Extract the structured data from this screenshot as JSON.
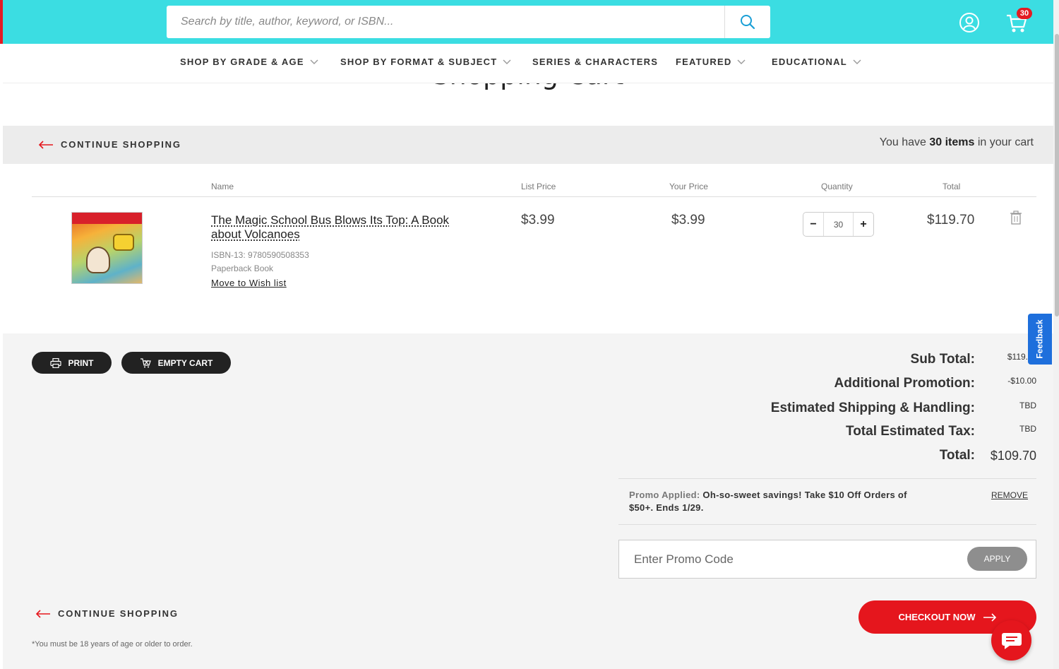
{
  "colors": {
    "header_bg": "#3bdde2",
    "accent_red": "#e5161d",
    "badge_red": "#e31b23",
    "feedback_blue": "#1e6fdc"
  },
  "header": {
    "search_placeholder": "Search by title, author, keyword, or ISBN...",
    "search_icon": "search-icon",
    "account_icon": "account-icon",
    "cart_icon": "cart-icon",
    "cart_badge": "30"
  },
  "nav": {
    "items": [
      {
        "label": "SHOP BY GRADE & AGE",
        "has_dropdown": true
      },
      {
        "label": "SHOP BY FORMAT & SUBJECT",
        "has_dropdown": true
      },
      {
        "label": "SERIES & CHARACTERS",
        "has_dropdown": false
      },
      {
        "label": "FEATURED",
        "has_dropdown": true
      },
      {
        "label": "EDUCATIONAL",
        "has_dropdown": true
      }
    ]
  },
  "page": {
    "title": "Shopping Cart"
  },
  "cart_bar": {
    "continue_label": "CONTINUE SHOPPING",
    "count_prefix": "You have",
    "count_value": "30 items",
    "count_suffix": "in your cart"
  },
  "table": {
    "headers": [
      "Name",
      "List Price",
      "Your Price",
      "Quantity",
      "Total"
    ],
    "rows": [
      {
        "title": "The Magic School Bus Blows Its Top: A Book about Volcanoes",
        "isbn": "ISBN-13: 9780590508353",
        "format": "Paperback Book",
        "wishlist": "Move to Wish list",
        "list_price": "$3.99",
        "your_price": "$3.99",
        "quantity": "30",
        "total": "$119.70"
      }
    ]
  },
  "actions": {
    "print_label": "PRINT",
    "empty_label": "EMPTY CART"
  },
  "summary": {
    "subtotal_label": "Sub Total:",
    "subtotal_value": "$119.",
    "promotion_label": "Additional Promotion:",
    "promotion_value": "-$10.00",
    "shipping_label": "Estimated Shipping & Handling:",
    "shipping_value": "TBD",
    "tax_label": "Total Estimated Tax:",
    "tax_value": "TBD",
    "total_label": "Total:",
    "total_value": "$109.70"
  },
  "promo": {
    "applied_label": "Promo Applied:",
    "applied_text": "Oh-so-sweet savings! Take $10 Off Orders of $50+. Ends 1/29.",
    "remove_label": "REMOVE",
    "input_placeholder": "Enter Promo Code",
    "apply_label": "APPLY"
  },
  "footer": {
    "continue_label": "CONTINUE SHOPPING",
    "checkout_label": "CHECKOUT NOW",
    "age_note": "*You must be 18 years of age or older to order."
  },
  "widgets": {
    "feedback_label": "Feedback",
    "chat_icon": "chat-icon"
  }
}
